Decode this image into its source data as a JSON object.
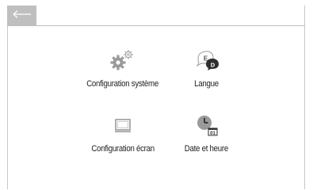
{
  "colors": {
    "topbar_button_bg": "#bfbfbf",
    "icon_gray": "#9a9a9a",
    "icon_dark": "#3a3a3a",
    "text": "#222222"
  },
  "header": {
    "back_icon": "back-arrow-icon"
  },
  "menu": {
    "items": [
      {
        "label": "Configuration système",
        "icon": "gears-icon"
      },
      {
        "label": "Langue",
        "icon": "language-bubbles-icon",
        "badge_left": "E",
        "badge_right": "D"
      },
      {
        "label": "Configuration écran",
        "icon": "monitor-icon"
      },
      {
        "label": "Date et heure",
        "icon": "clock-calendar-icon",
        "badge": "01"
      }
    ]
  }
}
